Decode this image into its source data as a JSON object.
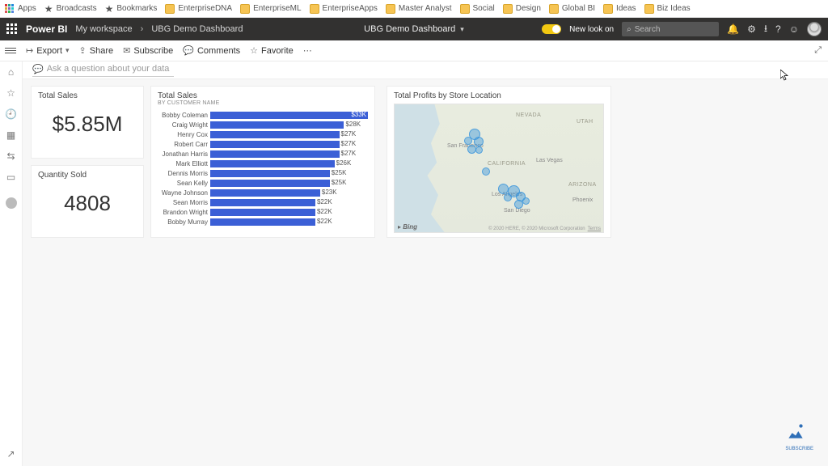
{
  "bookmarks": {
    "apps": "Apps",
    "items": [
      "Broadcasts",
      "Bookmarks",
      "EnterpriseDNA",
      "EnterpriseML",
      "EnterpriseApps",
      "Master Analyst",
      "Social",
      "Design",
      "Global BI",
      "Ideas",
      "Biz Ideas"
    ]
  },
  "nav": {
    "brand": "Power BI",
    "workspace": "My workspace",
    "dashboard": "UBG Demo Dashboard",
    "center_title": "UBG Demo Dashboard",
    "new_look": "New look on",
    "search_placeholder": "Search"
  },
  "cmd": {
    "export": "Export",
    "share": "Share",
    "subscribe": "Subscribe",
    "comments": "Comments",
    "favorite": "Favorite"
  },
  "qna": "Ask a question about your data",
  "tiles": {
    "total_sales_kpi": {
      "title": "Total Sales",
      "value": "$5.85M"
    },
    "qty_kpi": {
      "title": "Quantity Sold",
      "value": "4808"
    },
    "bars": {
      "title": "Total Sales",
      "subtitle": "BY CUSTOMER NAME"
    },
    "map": {
      "title": "Total Profits by Store Location",
      "bing": "Bing",
      "credit": "© 2020 HERE, © 2020 Microsoft Corporation",
      "terms": "Terms"
    }
  },
  "chart_data": {
    "type": "bar",
    "title": "Total Sales by Customer Name",
    "xlabel": "Sales",
    "ylabel": "Customer Name",
    "categories": [
      "Bobby Coleman",
      "Craig Wright",
      "Henry Cox",
      "Robert Carr",
      "Jonathan Harris",
      "Mark Elliott",
      "Dennis Morris",
      "Sean Kelly",
      "Wayne Johnson",
      "Sean Morris",
      "Brandon Wright",
      "Bobby Murray"
    ],
    "values": [
      33000,
      28000,
      27000,
      27000,
      27000,
      26000,
      25000,
      25000,
      23000,
      22000,
      22000,
      22000
    ],
    "value_labels": [
      "$33K",
      "$28K",
      "$27K",
      "$27K",
      "$27K",
      "$26K",
      "$25K",
      "$25K",
      "$23K",
      "$22K",
      "$22K",
      "$22K"
    ],
    "xlim": [
      0,
      33000
    ]
  },
  "map_labels": {
    "states": [
      "NEVADA",
      "UTAH",
      "CALIFORNIA",
      "ARIZONA"
    ],
    "cities": [
      "San Francisco",
      "Las Vegas",
      "Los Angeles",
      "San Diego",
      "Phoenix"
    ]
  }
}
